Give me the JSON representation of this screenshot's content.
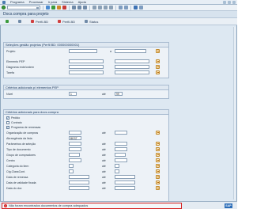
{
  "menubar": {
    "items": [
      "Programa",
      "Processar",
      "Ir para",
      "Sistema",
      "Ajuda"
    ]
  },
  "window": {
    "title": "Docs.compra para projeto"
  },
  "apptoolbar": {
    "buttons": [
      "Perfil-BD",
      "Perfil-BD",
      "Status"
    ]
  },
  "sections": {
    "project": {
      "title": "Seleções gestão projetos (Perfil BD: 000000000001)",
      "fields": {
        "project_label": "Projeto",
        "project_ate": "a",
        "wbs_label": "Elemento PEP",
        "network_label": "Diagrama rede/ordem",
        "activity_label": "Tarefa"
      }
    },
    "wbs_criteria": {
      "title": "Critérios adicionais p/ elementos PEP",
      "fields": {
        "level_label": "Nível",
        "level_from": "1",
        "level_ate": "até",
        "level_to": "99"
      }
    },
    "purch_criteria": {
      "title": "Critérios adicionais para docs.compra",
      "checkbox_order": "Pedido",
      "checkbox_contract": "Contrato",
      "checkbox_schedule": "Programa de remessas",
      "fields": {
        "purch_org_label": "Organização de compras",
        "list_scope_label": "Abrangência da lista",
        "list_scope_value": "BEST",
        "sel_params_label": "Parâmetros de seleção",
        "doc_type_label": "Tipo de documento",
        "purch_group_label": "Grupo de compradores",
        "plant_label": "Centro",
        "item_cat_label": "Categoria do item",
        "acct_assign_label": "Ctg.ClassCont.",
        "deliv_date_label": "Data de remessa",
        "validity_label": "Data de validade fixada",
        "doc_date_label": "Data do doc",
        "ate": "até"
      }
    }
  },
  "status": {
    "message": "Não foram encontrados documentos de compra adequados",
    "logo": "SAP"
  },
  "colors": {
    "accent": "#1c3a60",
    "error": "#d42020",
    "frame": "#dde8f2"
  }
}
